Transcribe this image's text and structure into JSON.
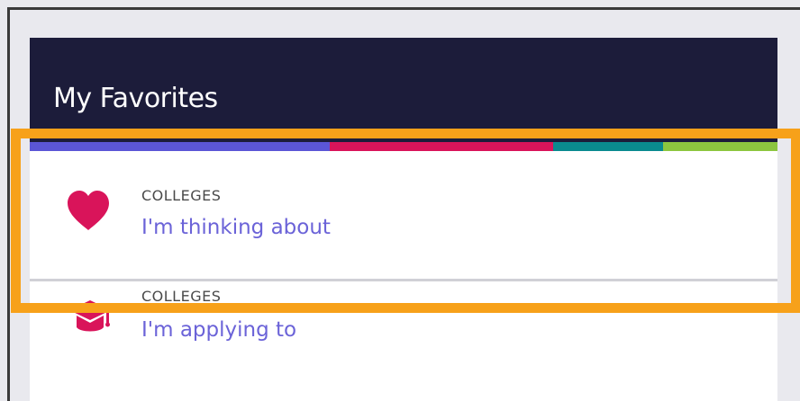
{
  "panel": {
    "title": "My Favorites"
  },
  "colors": {
    "header_bg": "#1c1c3a",
    "bar": [
      "#5b56d6",
      "#d9145a",
      "#0a8a8f",
      "#8cc63f"
    ],
    "accent_link": "#6b63d8",
    "icon": "#d9145a",
    "highlight": "#f7a11a"
  },
  "items": [
    {
      "icon": "heart-icon",
      "category": "COLLEGES",
      "label": "I'm thinking about"
    },
    {
      "icon": "graduation-cap-icon",
      "category": "COLLEGES",
      "label": "I'm applying to"
    }
  ]
}
